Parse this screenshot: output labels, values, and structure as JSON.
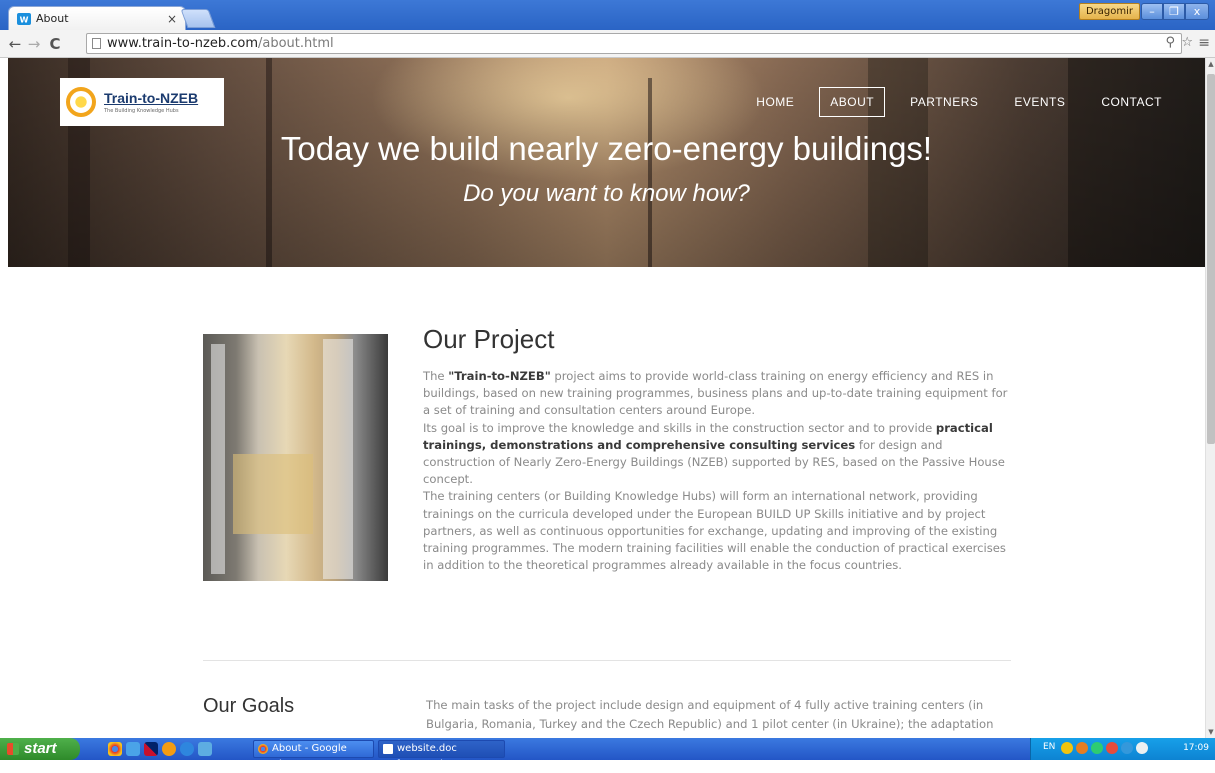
{
  "browser": {
    "tab_title": "About",
    "tab_close": "×",
    "user_name": "Dragomir",
    "url_host": "www.train-to-nzeb.com",
    "url_path": "/about.html"
  },
  "site": {
    "logo_title": "Train-to-NZEB",
    "logo_subtitle": "The Building Knowledge Hubs",
    "nav": [
      {
        "label": "HOME"
      },
      {
        "label": "ABOUT"
      },
      {
        "label": "PARTNERS"
      },
      {
        "label": "EVENTS"
      },
      {
        "label": "CONTACT"
      }
    ],
    "hero_title": "Today we build nearly zero-energy buildings!",
    "hero_subtitle": "Do you want to know how?"
  },
  "project": {
    "title": "Our Project",
    "p1_pre": "The ",
    "p1_bold": "\"Train-to-NZEB\"",
    "p1_post": " project aims to provide world-class training on energy efficiency and RES in buildings, based on new training programmes, business plans and up-to-date training equipment for a set of training and consultation centers around Europe.",
    "p2_pre": "Its goal is to improve the knowledge and skills in the construction sector and to provide ",
    "p2_bold": "practical trainings, demonstrations and comprehensive consulting services",
    "p2_post": " for design and construction of Nearly Zero-Energy Buildings (NZEB) supported by RES, based on the Passive House concept.",
    "p3": "The training centers (or Building Knowledge Hubs) will form an international network, providing trainings on the curricula developed under the European BUILD UP Skills initiative and by project partners, as well as continuous opportunities for exchange, updating and improving of the existing training programmes. The modern training facilities will enable the conduction of practical exercises in addition to the theoretical programmes already available in the focus countries."
  },
  "goals": {
    "title": "Our Goals",
    "text": "The main tasks of the project include design and equipment of 4 fully active training centers (in Bulgaria, Romania, Turkey and the Czech Republic) and 1 pilot center (in Ukraine); the adaptation"
  },
  "taskbar": {
    "start_label": "start",
    "task_chrome": "About - Google Chrome",
    "task_word": "website.doc [Compati...",
    "lang": "EN",
    "clock": "17:09"
  },
  "colors": {
    "accent_blue": "#2a64c5",
    "logo_orange": "#f2a51c",
    "text_gray": "#8a8a8a"
  }
}
